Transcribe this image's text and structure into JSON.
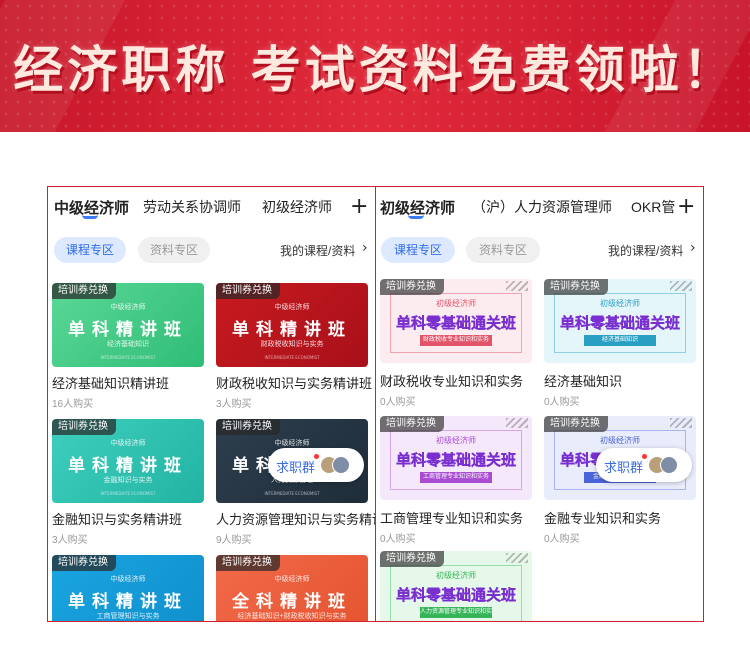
{
  "banner": {
    "title": "经济职称  考试资料免费领啦！"
  },
  "left": {
    "tabs": [
      "中级经济师",
      "劳动关系协调师",
      "初级经济师"
    ],
    "pill_on": "课程专区",
    "pill_off": "资料专区",
    "my_link": "我的课程/资料",
    "float_label": "求职群",
    "cards": [
      {
        "tag": "培训券兑换",
        "pre": "中级经济师",
        "big": "单科精讲班",
        "sub": "经济基础知识",
        "foot": "INTERMEDIATE ECONOMIST",
        "title": "经济基础知识精讲班",
        "buy": "16人购买",
        "color1": "#5bd897",
        "color2": "#2fbd76"
      },
      {
        "tag": "培训券兑换",
        "pre": "中级经济师",
        "big": "单科精讲班",
        "sub": "财政税收知识与实务",
        "foot": "INTERMEDIATE ECONOMIST",
        "title": "财政税收知识与实务精讲班",
        "buy": "3人购买",
        "color1": "#c81a1f",
        "color2": "#a8101a"
      },
      {
        "tag": "培训券兑换",
        "pre": "中级经济师",
        "big": "单科精讲班",
        "sub": "金融知识与实务",
        "foot": "INTERMEDIATE ECONOMIST",
        "title": "金融知识与实务精讲班",
        "buy": "3人购买",
        "color1": "#3fcfbf",
        "color2": "#22b3a3"
      },
      {
        "tag": "培训券兑换",
        "pre": "中级经济师",
        "big": "单科精讲班",
        "sub": "人力资源管理",
        "foot": "INTERMEDIATE ECONOMIST",
        "title": "人力资源管理知识与实务精讲班",
        "buy": "9人购买",
        "color1": "#2d3e4e",
        "color2": "#1f2d3a"
      },
      {
        "tag": "培训券兑换",
        "pre": "中级经济师",
        "big": "单科精讲班",
        "sub": "工商管理知识与实务",
        "foot": "",
        "title": "",
        "buy": "",
        "color1": "#1aa5e0",
        "color2": "#0f8fcc"
      },
      {
        "tag": "培训券兑换",
        "pre": "中级经济师",
        "big": "全科精讲班",
        "sub": "经济基础知识+财政税收知识与实务",
        "foot": "",
        "title": "",
        "buy": "",
        "color1": "#f26a4a",
        "color2": "#e4532f"
      }
    ]
  },
  "right": {
    "tabs": [
      "初级经济师",
      "（沪）人力资源管理师",
      "OKR管"
    ],
    "pill_on": "课程专区",
    "pill_off": "资料专区",
    "my_link": "我的课程/资料",
    "float_label": "求职群",
    "cards": [
      {
        "tag": "培训券兑换",
        "pre": "初级经济师",
        "big": "单科零基础通关班",
        "sub": "财政税收专业知识和实务",
        "title": "财政税收专业知识和实务",
        "buy": "0人购买",
        "bg": "#fdecef",
        "frame": "#f2a3b0",
        "subbg": "#e2546a"
      },
      {
        "tag": "培训券兑换",
        "pre": "初级经济师",
        "big": "单科零基础通关班",
        "sub": "经济基础知识",
        "title": "经济基础知识",
        "buy": "0人购买",
        "bg": "#e4f6fa",
        "frame": "#8fd3e3",
        "subbg": "#2a9fc4"
      },
      {
        "tag": "培训券兑换",
        "pre": "初级经济师",
        "big": "单科零基础通关班",
        "sub": "工商管理专业知识和实务",
        "title": "工商管理专业知识和实务",
        "buy": "0人购买",
        "bg": "#f6e8fb",
        "frame": "#d6a5ec",
        "subbg": "#a94bd3"
      },
      {
        "tag": "培训券兑换",
        "pre": "初级经济师",
        "big": "单科零基础通关班",
        "sub": "金融专业知识和实务",
        "title": "金融专业知识和实务",
        "buy": "0人购买",
        "bg": "#e8ecfb",
        "frame": "#a9b6ee",
        "subbg": "#4a63d8"
      },
      {
        "tag": "培训券兑换",
        "pre": "初级经济师",
        "big": "单科零基础通关班",
        "sub": "人力资源管理专业知识和实务",
        "title": "",
        "buy": "",
        "bg": "#e6f8ea",
        "frame": "#95dca6",
        "subbg": "#36b458"
      }
    ]
  }
}
